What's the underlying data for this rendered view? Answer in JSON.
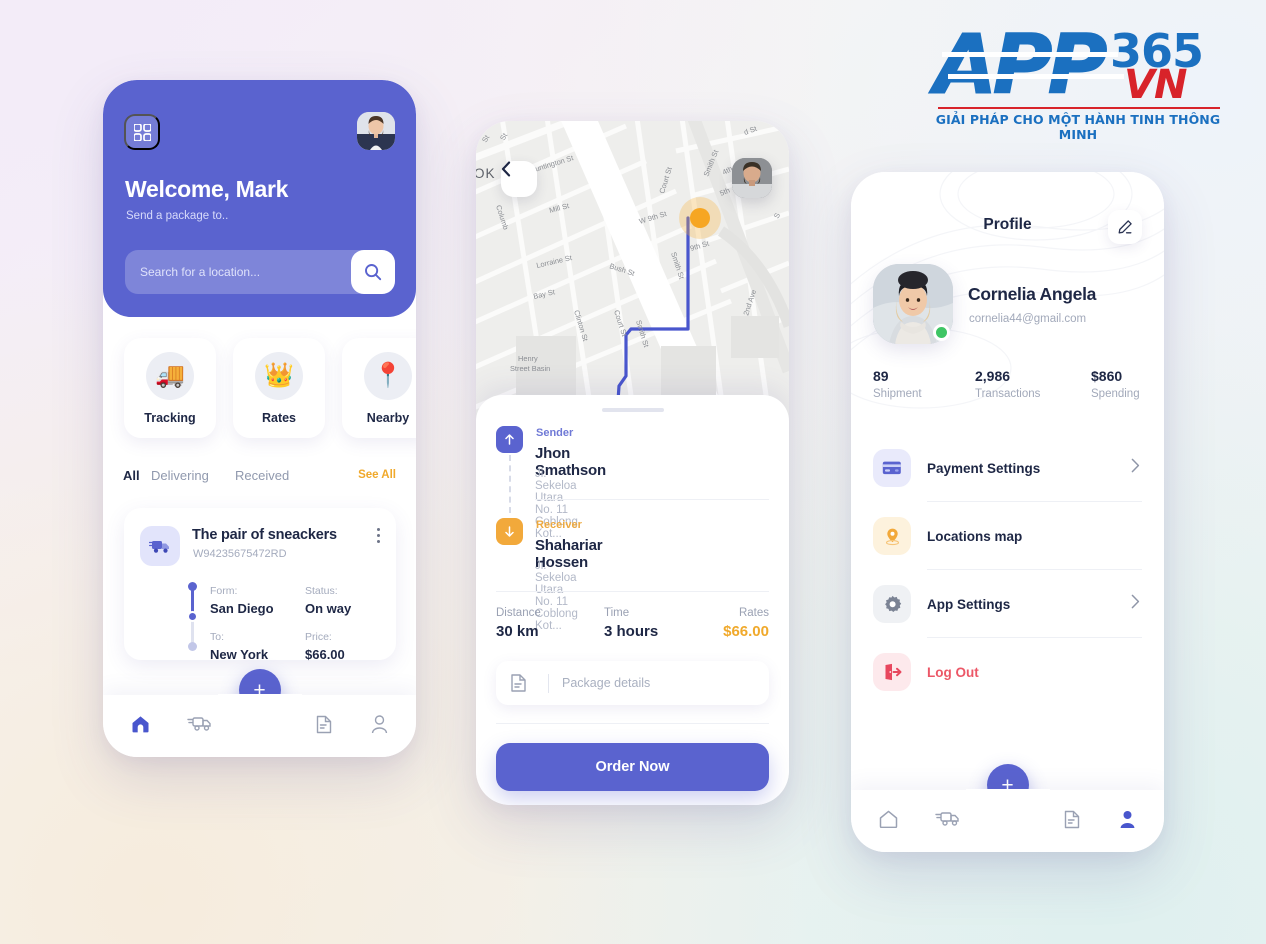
{
  "logo": {
    "app": "APP",
    "num": "365",
    "vn": "VN",
    "tagline": "GIẢI PHÁP CHO MỘT HÀNH TINH THÔNG MINH",
    "brand_blue": "#1b70c0",
    "brand_red": "#d8232a"
  },
  "theme": {
    "primary": "#5a63cf",
    "accent_orange": "#f0a92b",
    "danger": "#ec5767",
    "text_dark": "#1e2745",
    "text_muted": "#a2a9ba"
  },
  "home": {
    "grid_icon": "grid-icon",
    "avatar": "user-avatar",
    "title": "Welcome, Mark",
    "subtitle": "Send a package to..",
    "search": {
      "value": "",
      "placeholder": "Search for a location...",
      "icon": "search-icon"
    },
    "quick_actions": [
      {
        "label": "Tracking",
        "icon": "delivery-truck-icon",
        "glyph": "🚚"
      },
      {
        "label": "Rates",
        "icon": "crown-icon",
        "glyph": "👑"
      },
      {
        "label": "Nearby",
        "icon": "map-pin-icon",
        "glyph": "📍"
      }
    ],
    "tabs": [
      {
        "label": "All",
        "active": true
      },
      {
        "label": "Delivering",
        "active": false
      },
      {
        "label": "Received",
        "active": false
      }
    ],
    "see_all": "See All",
    "shipment": {
      "icon": "truck-icon",
      "title": "The pair of sneackers",
      "code": "W94235675472RD",
      "more_icon": "more-vertical-icon",
      "from_label": "Form:",
      "from_value": "San Diego",
      "status_label": "Status:",
      "status_value": "On way",
      "to_label": "To:",
      "to_value": "New York",
      "price_label": "Price:",
      "price_value": "$66.00"
    },
    "fab": "+",
    "nav": [
      {
        "icon": "home-icon",
        "active": true
      },
      {
        "icon": "truck-icon",
        "active": false
      },
      {
        "icon": "document-icon",
        "active": false
      },
      {
        "icon": "person-icon",
        "active": false
      }
    ]
  },
  "tracking": {
    "back_icon": "chevron-left-icon",
    "avatar": "courier-avatar",
    "map": {
      "area_label": "OK",
      "streets": [
        "Huntington St",
        "Mill St",
        "Lorraine St",
        "Bay St",
        "Columb",
        "Clinton St",
        "Bush St",
        "Court St",
        "Smith St",
        "W 9th St",
        "9th St",
        "Smith St",
        "2nd Ave",
        "Smith 4th",
        "Smith 5th",
        "Henry Street Basin",
        "d St",
        "St",
        "St"
      ],
      "origin_marker": "origin-dot",
      "destination_marker": "destination-dot"
    },
    "sender": {
      "role": "Sender",
      "name": "Jhon Smathson",
      "address": "Ji. Sekeloa Utara No. 11 Coblong Kot...",
      "icon": "arrow-up-icon"
    },
    "receiver": {
      "role": "Receiver",
      "name": "Shahariar Hossen",
      "address": "Ji. Sekeloa Utara No. 11 Coblong Kot...",
      "icon": "arrow-down-icon"
    },
    "metrics": [
      {
        "label": "Distance",
        "value": "30 km"
      },
      {
        "label": "Time",
        "value": "3 hours"
      },
      {
        "label": "Rates",
        "value": "$66.00"
      }
    ],
    "package_field": {
      "value": "",
      "placeholder": "Package details",
      "icon": "document-icon"
    },
    "order_button": "Order Now"
  },
  "profile": {
    "title": "Profile",
    "edit_icon": "edit-pencil-icon",
    "avatar": "profile-avatar",
    "online": true,
    "name": "Cornelia Angela",
    "email": "cornelia44@gmail.com",
    "stats": [
      {
        "value": "89",
        "label": "Shipment"
      },
      {
        "value": "2,986",
        "label": "Transactions"
      },
      {
        "value": "$860",
        "label": "Spending"
      }
    ],
    "menu": [
      {
        "label": "Payment Settings",
        "icon": "credit-card-icon",
        "chevron": true,
        "danger": false
      },
      {
        "label": "Locations map",
        "icon": "location-pin-icon",
        "chevron": false,
        "danger": false
      },
      {
        "label": "App Settings",
        "icon": "gear-icon",
        "chevron": true,
        "danger": false
      },
      {
        "label": "Log Out",
        "icon": "logout-icon",
        "chevron": false,
        "danger": true
      }
    ],
    "fab": "+",
    "nav": [
      {
        "icon": "home-icon",
        "active": false
      },
      {
        "icon": "truck-icon",
        "active": false
      },
      {
        "icon": "document-icon",
        "active": false
      },
      {
        "icon": "person-icon",
        "active": true
      }
    ]
  }
}
